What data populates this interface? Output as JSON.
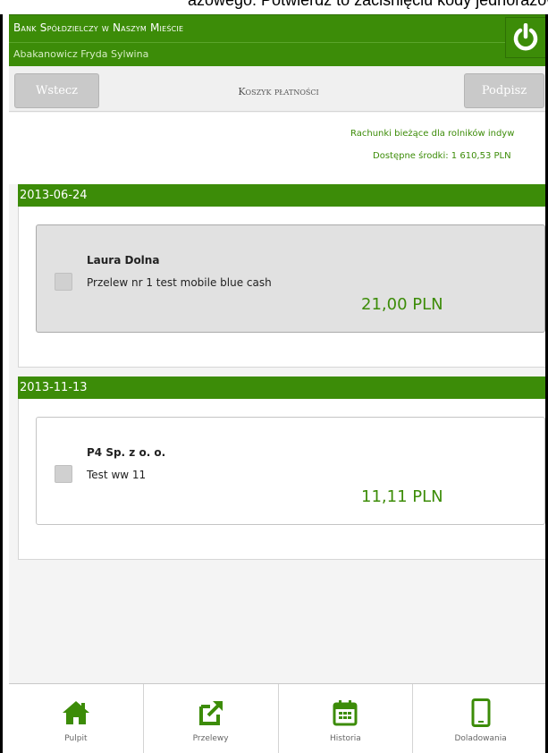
{
  "top_overlay": {
    "text": "azowego. Potwierdź to zaciśnięciu kody jednorazowe"
  },
  "header": {
    "bank_name": "Bank Spółdzielczy w Naszym Mieście",
    "user_name": "Abakanowicz Fryda Sylwina",
    "power_icon": "power-icon"
  },
  "toolbar": {
    "back_label": "Wstecz",
    "title": "Koszyk płatności",
    "sign_label": "Podpisz"
  },
  "account": {
    "name": "Rachunki bieżące dla rolników indyw",
    "funds": "Dostępne środki: 1 610,53 PLN"
  },
  "groups": [
    {
      "date": "2013-06-24",
      "payments": [
        {
          "recipient": "Laura Dolna",
          "title": "Przelew nr 1 test mobile blue cash",
          "amount": "21,00 PLN",
          "selected": true
        }
      ]
    },
    {
      "date": "2013-11-13",
      "payments": [
        {
          "recipient": "P4 Sp. z o. o.",
          "title": "Test ww 11",
          "amount": "11,11 PLN",
          "selected": false
        }
      ]
    }
  ],
  "bottom_nav": [
    {
      "label": "Pulpit",
      "icon": "home-icon"
    },
    {
      "label": "Przelewy",
      "icon": "transfer-icon"
    },
    {
      "label": "Historia",
      "icon": "calendar-icon"
    },
    {
      "label": "Doladowania",
      "icon": "phone-icon"
    }
  ],
  "colors": {
    "brand_green": "#3c8c08",
    "button_gray": "#c9c9c9"
  }
}
